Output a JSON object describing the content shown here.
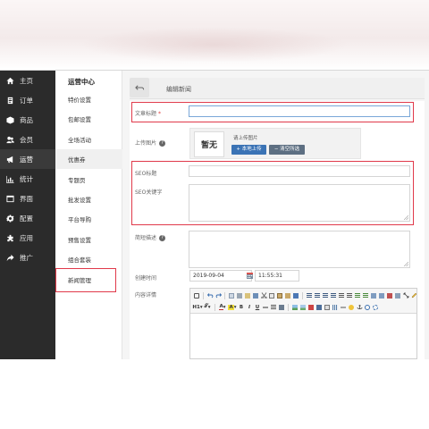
{
  "sidebar": {
    "items": [
      {
        "label": "主页",
        "icon": "home-icon"
      },
      {
        "label": "订单",
        "icon": "order-icon"
      },
      {
        "label": "商品",
        "icon": "product-icon"
      },
      {
        "label": "会员",
        "icon": "members-icon"
      },
      {
        "label": "运营",
        "icon": "megaphone-icon",
        "active": true
      },
      {
        "label": "统计",
        "icon": "bar-chart-icon"
      },
      {
        "label": "界面",
        "icon": "layout-icon"
      },
      {
        "label": "配置",
        "icon": "gear-icon"
      },
      {
        "label": "应用",
        "icon": "apps-icon"
      },
      {
        "label": "推广",
        "icon": "share-icon"
      }
    ]
  },
  "submenu": {
    "title": "运营中心",
    "items": [
      "特价设置",
      "包邮设置",
      "全场活动",
      "优惠券",
      "专题页",
      "批发设置",
      "平台导购",
      "预售设置",
      "组合套装",
      "新闻管理"
    ]
  },
  "header": {
    "title": "编辑新闻"
  },
  "form": {
    "title_label": "文章标题",
    "required_mark": "*",
    "title_value": "",
    "upload_label": "上传图片",
    "preview_text": "暂无",
    "upload_hint": "请上传图片",
    "upload_button": "+ 本地上传",
    "clear_button": "− 清空所选",
    "seo_title_label": "SEO标题",
    "seo_keywords_label": "SEO关键字",
    "summary_label": "简短描述",
    "created_label": "创建时间",
    "created_date": "2019-09-04",
    "created_time": "11:55:31",
    "content_label": "内容详情"
  },
  "editor": {
    "toolbar_row2_labels": [
      "H1",
      "𝒯",
      "A",
      "B",
      "I",
      "U"
    ]
  },
  "colors": {
    "sidebar_bg": "#2b2b2b",
    "highlight_border": "#e0394a",
    "primary_button": "#3b73b5",
    "secondary_button": "#5d6f82"
  }
}
